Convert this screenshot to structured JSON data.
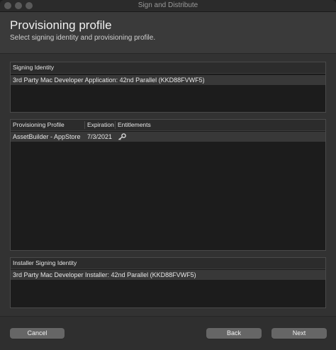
{
  "window": {
    "title": "Sign and Distribute"
  },
  "header": {
    "title": "Provisioning profile",
    "subtitle": "Select signing identity and provisioning profile."
  },
  "signing_identity": {
    "header": "Signing Identity",
    "rows": [
      "3rd Party Mac Developer Application: 42nd Parallel (KKD88FVWF5)"
    ]
  },
  "provisioning": {
    "columns": [
      "Provisioning Profile",
      "Expiration",
      "Entitlements"
    ],
    "rows": [
      {
        "profile": "AssetBuilder - AppStore",
        "expiration": "7/3/2021",
        "entitlements_icon": "key-icon"
      }
    ]
  },
  "installer_identity": {
    "header": "Installer Signing Identity",
    "rows": [
      "3rd Party Mac Developer Installer: 42nd Parallel (KKD88FVWF5)"
    ]
  },
  "footer": {
    "cancel_label": "Cancel",
    "back_label": "Back",
    "next_label": "Next"
  }
}
